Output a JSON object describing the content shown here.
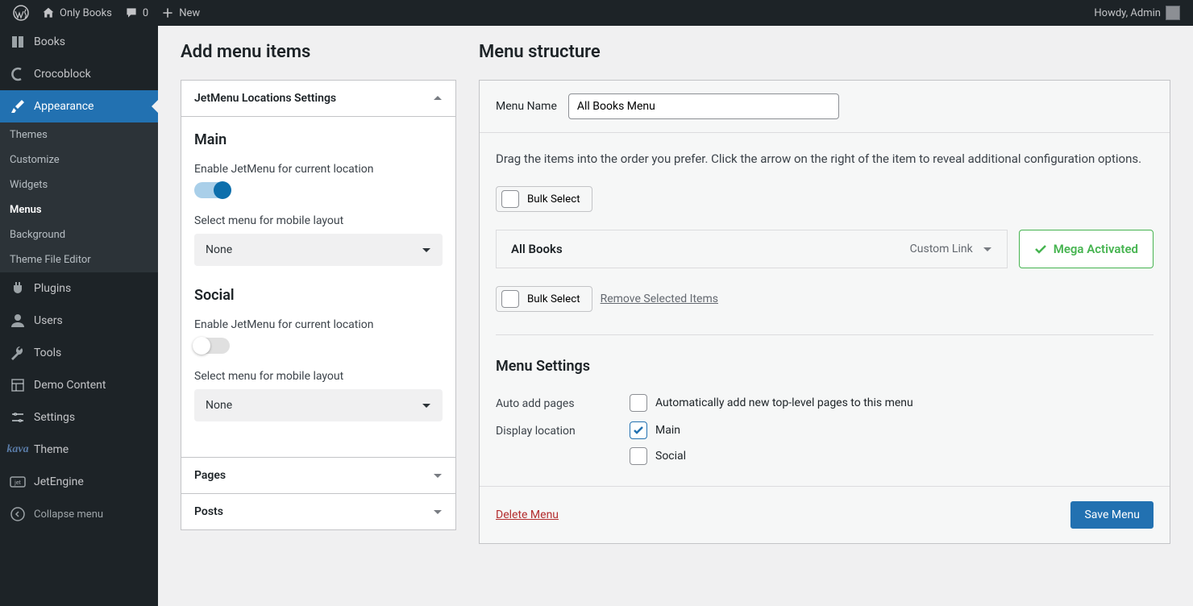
{
  "adminbar": {
    "site_name": "Only Books",
    "comments_count": "0",
    "new_label": "New",
    "howdy": "Howdy, Admin"
  },
  "sidebar": {
    "items": [
      {
        "label": "Books"
      },
      {
        "label": "Crocoblock"
      },
      {
        "label": "Appearance"
      },
      {
        "label": "Plugins"
      },
      {
        "label": "Users"
      },
      {
        "label": "Tools"
      },
      {
        "label": "Demo Content"
      },
      {
        "label": "Settings"
      },
      {
        "label": "Theme"
      },
      {
        "label": "JetEngine"
      }
    ],
    "appearance_sub": [
      "Themes",
      "Customize",
      "Widgets",
      "Menus",
      "Background",
      "Theme File Editor"
    ],
    "collapse": "Collapse menu"
  },
  "left": {
    "heading": "Add menu items",
    "jetmenu": {
      "title": "JetMenu Locations Settings",
      "locations": [
        {
          "name": "Main",
          "enable_label": "Enable JetMenu for current location",
          "enabled": true,
          "select_label": "Select menu for mobile layout",
          "selected": "None"
        },
        {
          "name": "Social",
          "enable_label": "Enable JetMenu for current location",
          "enabled": false,
          "select_label": "Select menu for mobile layout",
          "selected": "None"
        }
      ]
    },
    "pages": "Pages",
    "posts": "Posts"
  },
  "right": {
    "heading": "Menu structure",
    "menu_name_label": "Menu Name",
    "menu_name_value": "All Books Menu",
    "instructions": "Drag the items into the order you prefer. Click the arrow on the right of the item to reveal additional configuration options.",
    "bulk_select": "Bulk Select",
    "menu_item": {
      "name": "All Books",
      "type": "Custom Link"
    },
    "mega_badge": "Mega Activated",
    "remove_selected": "Remove Selected Items",
    "settings": {
      "heading": "Menu Settings",
      "auto_label": "Auto add pages",
      "auto_option": "Automatically add new top-level pages to this menu",
      "display_label": "Display location",
      "loc_main": "Main",
      "loc_social": "Social"
    },
    "delete": "Delete Menu",
    "save": "Save Menu"
  }
}
